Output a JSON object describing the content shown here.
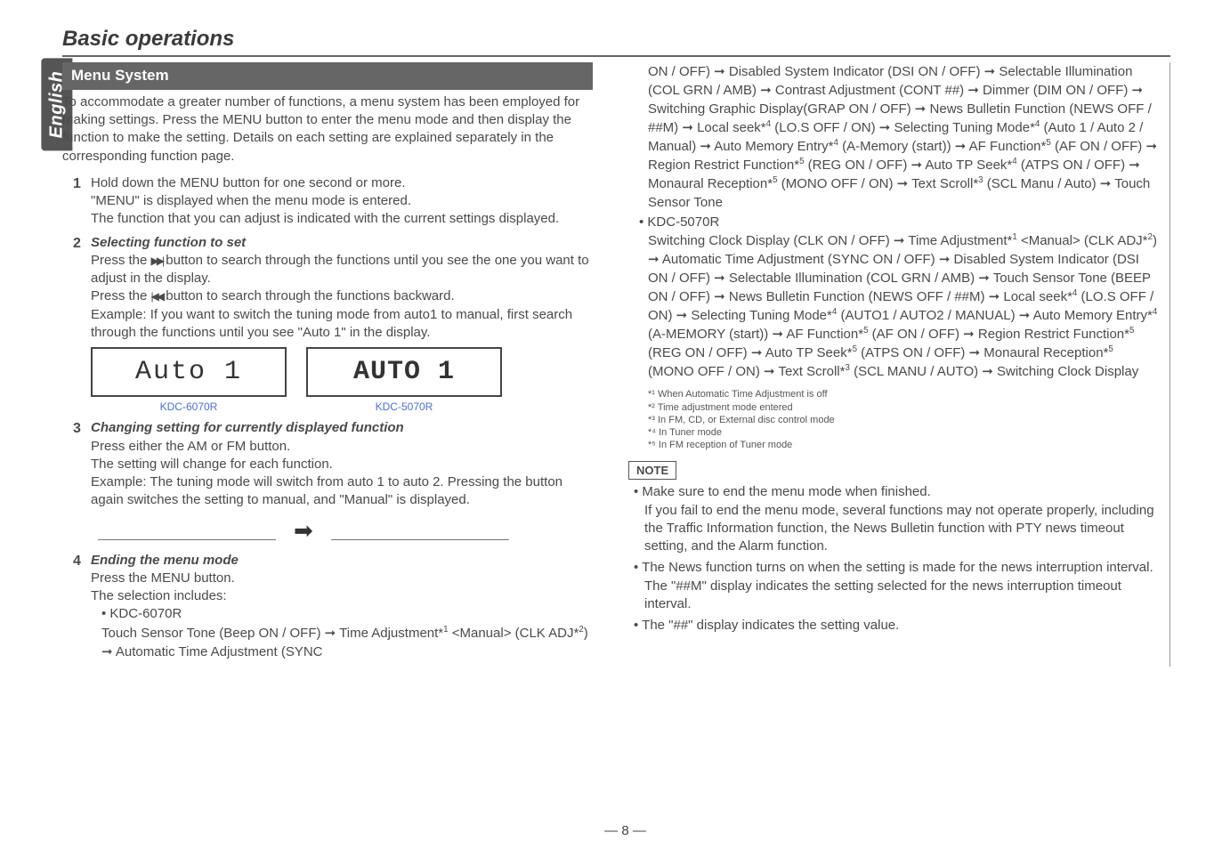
{
  "language_tab": "English",
  "page_title": "Basic operations",
  "section_header": "Menu System",
  "intro": "To accommodate a greater number of functions, a menu system has been employed for making settings.  Press the MENU button to enter the menu mode and then display the function to make the setting.  Details on each setting are explained separately in the corresponding function page.",
  "steps": {
    "s1_text": "Hold down the MENU button for one second or more.\n \"MENU\" is displayed when the menu mode is entered.\nThe function that you can adjust is indicated with the current settings displayed.",
    "s2_title": "Selecting function to set",
    "s2_line1a": "Press the ",
    "s2_line1b": " button to search through the functions until you see the one you want to adjust in the display.",
    "s2_line2a": "Press the ",
    "s2_line2b": " button to search through the functions backward.",
    "s2_example": "Example: If you want to switch the tuning mode from auto1 to manual, first search through the functions until you see \"Auto 1\" in the display.",
    "lcd1_text": "Auto 1",
    "lcd2_text": "AUTO 1",
    "lcd1_label": "KDC-6070R",
    "lcd2_label": "KDC-5070R",
    "s3_title": "Changing setting for currently displayed function",
    "s3_text": "Press either the AM or FM button.\nThe setting will change for each function.\nExample: The tuning mode will switch from auto 1 to auto 2. Pressing the button again switches the setting to manual, and \"Manual\" is displayed.",
    "s4_title": "Ending the menu mode",
    "s4_line1": "Press the MENU button.",
    "s4_line2": "The selection includes:",
    "s4_model1": "KDC-6070R",
    "s4_model1_flow_a": "Touch Sensor Tone (Beep ON / OFF)",
    "s4_model1_flow_b": "Time Adjustment*",
    "s4_model1_flow_c": " <Manual> (CLK ADJ*",
    "s4_model1_flow_d": "Automatic Time Adjustment (SYNC"
  },
  "right_flow": {
    "part1": "ON / OFF) ➞ Disabled System Indicator (DSI ON / OFF) ➞ Selectable Illumination (COL GRN / AMB) ➞ Contrast Adjustment (CONT ##) ➞ Dimmer (DIM ON / OFF) ➞ Switching Graphic Display(GRAP ON / OFF) ➞ News Bulletin Function (NEWS OFF / ##M) ➞ Local seek*",
    "part1b": " (LO.S OFF / ON) ➞ Selecting Tuning Mode*",
    "part1c": " (Auto 1 / Auto 2 / Manual) ➞ Auto Memory Entry*",
    "part1d": " (A-Memory (start)) ➞ AF Function*",
    "part1e": " (AF ON / OFF) ➞ Region Restrict Function*",
    "part1f": " (REG ON / OFF) ➞ Auto TP Seek*",
    "part1g": " (ATPS ON / OFF) ➞ Monaural Reception*",
    "part1h": " (MONO OFF / ON) ➞ Text Scroll*",
    "part1i": " (SCL Manu / Auto) ➞ Touch Sensor Tone",
    "model2": "KDC-5070R",
    "part2a": "Switching Clock Display (CLK ON / OFF) ➞ Time Adjustment*",
    "part2b": " <Manual> (CLK ADJ*",
    "part2c": ") ➞ Automatic Time Adjustment (SYNC ON / OFF) ➞ Disabled System Indicator (DSI ON / OFF) ➞ Selectable Illumination (COL GRN / AMB) ➞ Touch Sensor Tone (BEEP ON / OFF) ➞ News Bulletin Function (NEWS OFF / ##M) ➞ Local seek*",
    "part2d": " (LO.S OFF / ON) ➞ Selecting Tuning Mode*",
    "part2e": " (AUTO1 / AUTO2 / MANUAL) ➞ Auto Memory Entry*",
    "part2f": " (A-MEMORY (start)) ➞ AF Function*",
    "part2g": " (AF ON / OFF) ➞ Region Restrict Function*",
    "part2h": " (REG ON / OFF) ➞ Auto TP Seek*",
    "part2i": " (ATPS ON / OFF) ➞ Monaural Reception*",
    "part2j": " (MONO OFF / ON) ➞ Text Scroll*",
    "part2k": " (SCL MANU / AUTO) ➞ Switching Clock Display"
  },
  "footnotes": {
    "f1": "*¹ When Automatic Time Adjustment is off",
    "f2": "*² Time adjustment mode entered",
    "f3": "*³ In FM, CD, or External disc control mode",
    "f4": "*⁴ In Tuner mode",
    "f5": "*⁵ In FM reception of Tuner mode"
  },
  "note_label": "NOTE",
  "notes": {
    "n1": "Make sure to end the menu mode when finished.\nIf you fail to end the menu mode, several functions may not operate properly, including the Traffic Information function, the News Bulletin function with PTY news timeout setting, and the Alarm function.",
    "n2": "The News function turns on when the setting is made for the news interruption interval.  The \"##M\" display indicates the setting selected for the news interruption timeout interval.",
    "n3": "The \"##\" display indicates the setting value."
  },
  "page_number": "— 8 —"
}
